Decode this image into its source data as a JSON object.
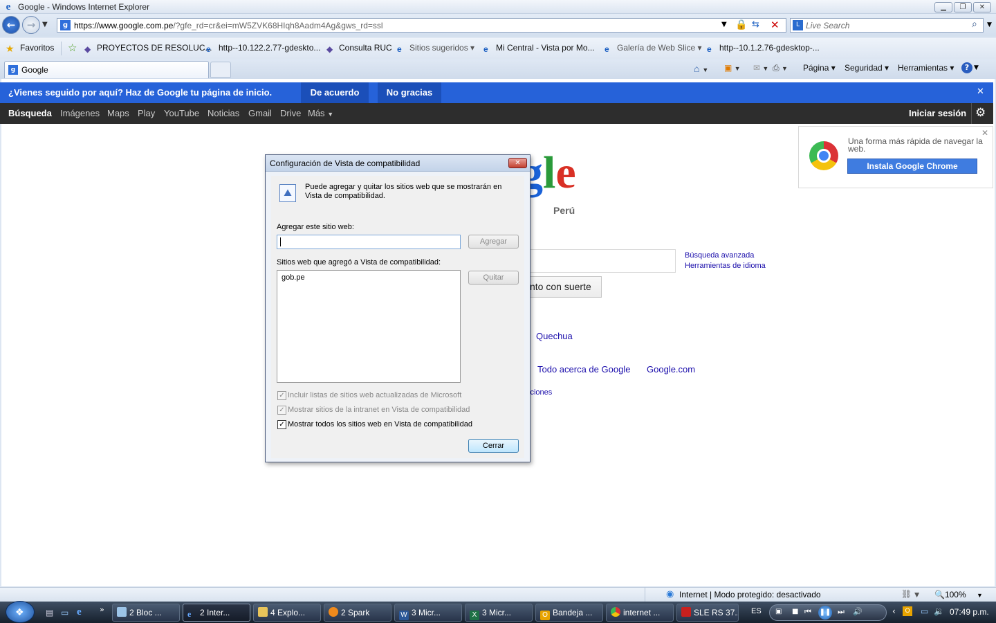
{
  "window": {
    "title": "Google - Windows Internet Explorer"
  },
  "address": {
    "url_main": "https://www.google.com.pe",
    "url_rest": "/?gfe_rd=cr&ei=mW5ZVK68HIqh8Aadm4Ag&gws_rd=ssl"
  },
  "search": {
    "placeholder": "Live Search"
  },
  "favorites": {
    "label": "Favoritos",
    "items": [
      "PROYECTOS DE RESOLUC...",
      "http--10.122.2.77-gdeskto...",
      "Consulta RUC",
      "Sitios sugeridos",
      "Mi Central - Vista por Mo...",
      "Galería de Web Slice",
      "http--10.1.2.76-gdesktop-..."
    ]
  },
  "tab": {
    "label": "Google"
  },
  "commandbar": {
    "page": "Página",
    "safety": "Seguridad",
    "tools": "Herramientas"
  },
  "promo": {
    "message": "¿Vienes seguido por aquí? Haz de Google tu página de inicio.",
    "accept": "De acuerdo",
    "decline": "No gracias"
  },
  "gbar": {
    "items": [
      "Búsqueda",
      "Imágenes",
      "Maps",
      "Play",
      "YouTube",
      "Noticias",
      "Gmail",
      "Drive",
      "Más"
    ],
    "signin": "Iniciar sesión"
  },
  "google": {
    "country": "Perú",
    "advanced": "Búsqueda avanzada",
    "language_tools": "Herramientas de idioma",
    "lucky": "nto con suerte",
    "lang_link": "Quechua",
    "about": "Todo acerca de Google",
    "dotcom": "Google.com",
    "terms": "iciones"
  },
  "chrome_promo": {
    "text": "Una forma más rápida de navegar la web.",
    "button": "Instala Google Chrome"
  },
  "dialog": {
    "title": "Configuración de Vista de compatibilidad",
    "description_line1": "Puede agregar y quitar los sitios web que se mostrarán en",
    "description_line2": "Vista de compatibilidad.",
    "add_label": "Agregar este sitio web:",
    "add_value": "",
    "add_button": "Agregar",
    "list_label": "Sitios web que agregó a Vista de compatibilidad:",
    "sites": [
      "gob.pe"
    ],
    "remove_button": "Quitar",
    "option1": "Incluir listas de sitios web actualizadas de Microsoft",
    "option2": "Mostrar sitios de la intranet en Vista de compatibilidad",
    "option3": "Mostrar todos los sitios web en Vista de compatibilidad",
    "close_button": "Cerrar"
  },
  "status": {
    "zone": "Internet | Modo protegido: desactivado",
    "zoom": "100%"
  },
  "taskbar": {
    "items": [
      "2 Bloc ...",
      "2 Inter...",
      "4 Explo...",
      "2 Spark",
      "3 Micr...",
      "3 Micr...",
      "Bandeja ...",
      "internet ...",
      "SLE RS 37..."
    ],
    "lang": "ES",
    "clock": "07:49 p.m."
  }
}
